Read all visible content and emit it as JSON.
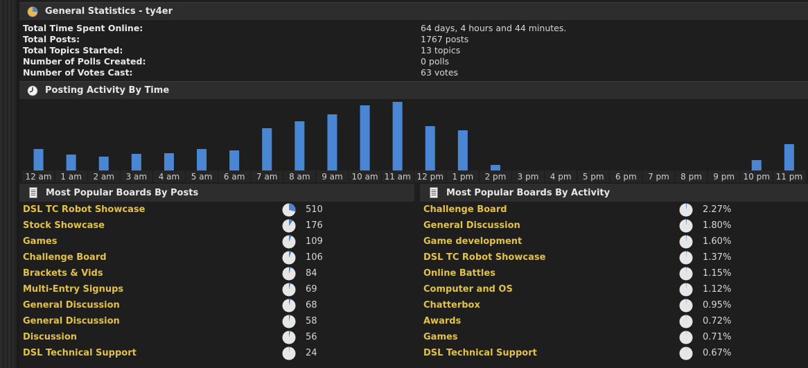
{
  "general": {
    "title": "General Statistics - ty4er",
    "stats": [
      {
        "label": "Total Time Spent Online:",
        "value": "64 days, 4 hours and 44 minutes."
      },
      {
        "label": "Total Posts:",
        "value": "1767 posts"
      },
      {
        "label": "Total Topics Started:",
        "value": "13 topics"
      },
      {
        "label": "Number of Polls Created:",
        "value": "0 polls"
      },
      {
        "label": "Number of Votes Cast:",
        "value": "63 votes"
      }
    ]
  },
  "activity": {
    "title": "Posting Activity By Time"
  },
  "chart_data": {
    "type": "bar",
    "title": "Posting Activity By Time",
    "categories": [
      "12 am",
      "1 am",
      "2 am",
      "3 am",
      "4 am",
      "5 am",
      "6 am",
      "7 am",
      "8 am",
      "9 am",
      "10 am",
      "11 am",
      "12 pm",
      "1 pm",
      "2 pm",
      "3 pm",
      "4 pm",
      "5 pm",
      "6 pm",
      "7 pm",
      "8 pm",
      "9 pm",
      "10 pm",
      "11 pm"
    ],
    "values": [
      31,
      23,
      20,
      24,
      25,
      31,
      29,
      61,
      71,
      81,
      94,
      99,
      64,
      58,
      8,
      0,
      0,
      0,
      0,
      0,
      0,
      0,
      15,
      38
    ],
    "ylim": [
      0,
      100
    ],
    "bar_color": "#4a86d4",
    "grid": false
  },
  "colors": {
    "pie_fill": "#e6e6e6",
    "pie_accent": "#4a86d4",
    "link": "#e2c14a"
  },
  "boards_by_posts": {
    "title": "Most Popular Boards By Posts",
    "icon": "document-icon",
    "rows": [
      {
        "name": "DSL TC Robot Showcase",
        "value": "510",
        "share": 0.289
      },
      {
        "name": "Stock Showcase",
        "value": "176",
        "share": 0.1
      },
      {
        "name": "Games",
        "value": "109",
        "share": 0.062
      },
      {
        "name": "Challenge Board",
        "value": "106",
        "share": 0.06
      },
      {
        "name": "Brackets & Vids",
        "value": "84",
        "share": 0.048
      },
      {
        "name": "Multi-Entry Signups",
        "value": "69",
        "share": 0.039
      },
      {
        "name": "General Discussion",
        "value": "68",
        "share": 0.038
      },
      {
        "name": "General Discussion",
        "value": "58",
        "share": 0.033
      },
      {
        "name": "Discussion",
        "value": "56",
        "share": 0.032
      },
      {
        "name": "DSL Technical Support",
        "value": "24",
        "share": 0.014
      }
    ]
  },
  "boards_by_activity": {
    "title": "Most Popular Boards By Activity",
    "icon": "document-icon",
    "rows": [
      {
        "name": "Challenge Board",
        "value": "2.27%",
        "share": 0.0227
      },
      {
        "name": "General Discussion",
        "value": "1.80%",
        "share": 0.018
      },
      {
        "name": "Game development",
        "value": "1.60%",
        "share": 0.016
      },
      {
        "name": "DSL TC Robot Showcase",
        "value": "1.37%",
        "share": 0.0137
      },
      {
        "name": "Online Battles",
        "value": "1.15%",
        "share": 0.0115
      },
      {
        "name": "Computer and OS",
        "value": "1.12%",
        "share": 0.0112
      },
      {
        "name": "Chatterbox",
        "value": "0.95%",
        "share": 0.0095
      },
      {
        "name": "Awards",
        "value": "0.72%",
        "share": 0.0072
      },
      {
        "name": "Games",
        "value": "0.71%",
        "share": 0.0071
      },
      {
        "name": "DSL Technical Support",
        "value": "0.67%",
        "share": 0.0067
      }
    ]
  }
}
